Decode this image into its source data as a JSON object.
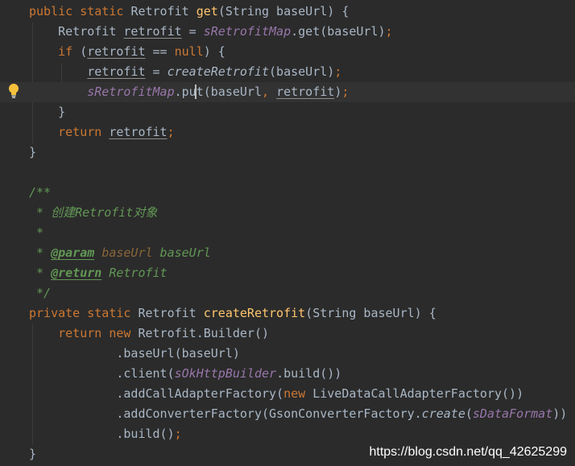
{
  "watermark": "https://blog.csdn.net/qq_42625299",
  "lines": [
    {
      "row": 0,
      "segments": [
        {
          "t": "public static ",
          "c": "kw"
        },
        {
          "t": "Retrofit ",
          "c": ""
        },
        {
          "t": "get",
          "c": "fn"
        },
        {
          "t": "(String baseUrl) {",
          "c": ""
        }
      ]
    },
    {
      "row": 1,
      "segments": [
        {
          "t": "    Retrofit ",
          "c": ""
        },
        {
          "t": "retrofit",
          "c": "ul"
        },
        {
          "t": " = ",
          "c": ""
        },
        {
          "t": "sRetrofitMap",
          "c": "st"
        },
        {
          "t": ".get(baseUrl)",
          "c": ""
        },
        {
          "t": ";",
          "c": "kw"
        }
      ]
    },
    {
      "row": 2,
      "segments": [
        {
          "t": "    ",
          "c": ""
        },
        {
          "t": "if ",
          "c": "kw"
        },
        {
          "t": "(",
          "c": ""
        },
        {
          "t": "retrofit",
          "c": "ul"
        },
        {
          "t": " == ",
          "c": ""
        },
        {
          "t": "null",
          "c": "kw"
        },
        {
          "t": ") {",
          "c": ""
        }
      ]
    },
    {
      "row": 3,
      "segments": [
        {
          "t": "        ",
          "c": ""
        },
        {
          "t": "retrofit",
          "c": "ul"
        },
        {
          "t": " = ",
          "c": ""
        },
        {
          "t": "createRetrofit",
          "c": "it"
        },
        {
          "t": "(baseUrl)",
          "c": ""
        },
        {
          "t": ";",
          "c": "kw"
        }
      ]
    },
    {
      "row": 4,
      "current": true,
      "segments": [
        {
          "t": "        ",
          "c": ""
        },
        {
          "t": "sRetrofitMap",
          "c": "st"
        },
        {
          "t": ".put(baseUrl",
          "c": ""
        },
        {
          "t": ", ",
          "c": "kw"
        },
        {
          "t": "retrofit",
          "c": "ul"
        },
        {
          "t": ")",
          "c": ""
        },
        {
          "t": ";",
          "c": "kw"
        }
      ]
    },
    {
      "row": 5,
      "segments": [
        {
          "t": "    }",
          "c": ""
        }
      ]
    },
    {
      "row": 6,
      "segments": [
        {
          "t": "    ",
          "c": ""
        },
        {
          "t": "return ",
          "c": "kw"
        },
        {
          "t": "retrofit",
          "c": "ul"
        },
        {
          "t": ";",
          "c": "kw"
        }
      ]
    },
    {
      "row": 7,
      "segments": [
        {
          "t": "}",
          "c": ""
        }
      ]
    },
    {
      "row": 8,
      "segments": []
    },
    {
      "row": 9,
      "segments": [
        {
          "t": "/**",
          "c": "cm"
        }
      ]
    },
    {
      "row": 10,
      "segments": [
        {
          "t": " * 创建Retrofit对象",
          "c": "cm"
        }
      ]
    },
    {
      "row": 11,
      "segments": [
        {
          "t": " *",
          "c": "cm"
        }
      ]
    },
    {
      "row": 12,
      "segments": [
        {
          "t": " * ",
          "c": "cm"
        },
        {
          "t": "@param",
          "c": "tg"
        },
        {
          "t": " ",
          "c": "cm"
        },
        {
          "t": "baseUrl",
          "c": "pn"
        },
        {
          "t": " baseUrl",
          "c": "cm"
        }
      ]
    },
    {
      "row": 13,
      "segments": [
        {
          "t": " * ",
          "c": "cm"
        },
        {
          "t": "@return",
          "c": "tg"
        },
        {
          "t": " Retrofit",
          "c": "cm"
        }
      ]
    },
    {
      "row": 14,
      "segments": [
        {
          "t": " */",
          "c": "cm"
        }
      ]
    },
    {
      "row": 15,
      "segments": [
        {
          "t": "private static ",
          "c": "kw"
        },
        {
          "t": "Retrofit ",
          "c": ""
        },
        {
          "t": "createRetrofit",
          "c": "fn"
        },
        {
          "t": "(String baseUrl) {",
          "c": ""
        }
      ]
    },
    {
      "row": 16,
      "segments": [
        {
          "t": "    ",
          "c": ""
        },
        {
          "t": "return new ",
          "c": "kw"
        },
        {
          "t": "Retrofit.Builder()",
          "c": ""
        }
      ]
    },
    {
      "row": 17,
      "segments": [
        {
          "t": "            .baseUrl(baseUrl)",
          "c": ""
        }
      ]
    },
    {
      "row": 18,
      "segments": [
        {
          "t": "            .client(",
          "c": ""
        },
        {
          "t": "sOkHttpBuilder",
          "c": "st"
        },
        {
          "t": ".build())",
          "c": ""
        }
      ]
    },
    {
      "row": 19,
      "segments": [
        {
          "t": "            .addCallAdapterFactory(",
          "c": ""
        },
        {
          "t": "new ",
          "c": "kw"
        },
        {
          "t": "LiveDataCallAdapterFactory())",
          "c": ""
        }
      ]
    },
    {
      "row": 20,
      "segments": [
        {
          "t": "            .addConverterFactory(GsonConverterFactory.",
          "c": ""
        },
        {
          "t": "create",
          "c": "it"
        },
        {
          "t": "(",
          "c": ""
        },
        {
          "t": "sDataFormat",
          "c": "st"
        },
        {
          "t": "))",
          "c": ""
        }
      ]
    },
    {
      "row": 21,
      "segments": [
        {
          "t": "            .build()",
          "c": ""
        },
        {
          "t": ";",
          "c": "kw"
        }
      ]
    },
    {
      "row": 22,
      "segments": [
        {
          "t": "}",
          "c": ""
        }
      ]
    }
  ]
}
